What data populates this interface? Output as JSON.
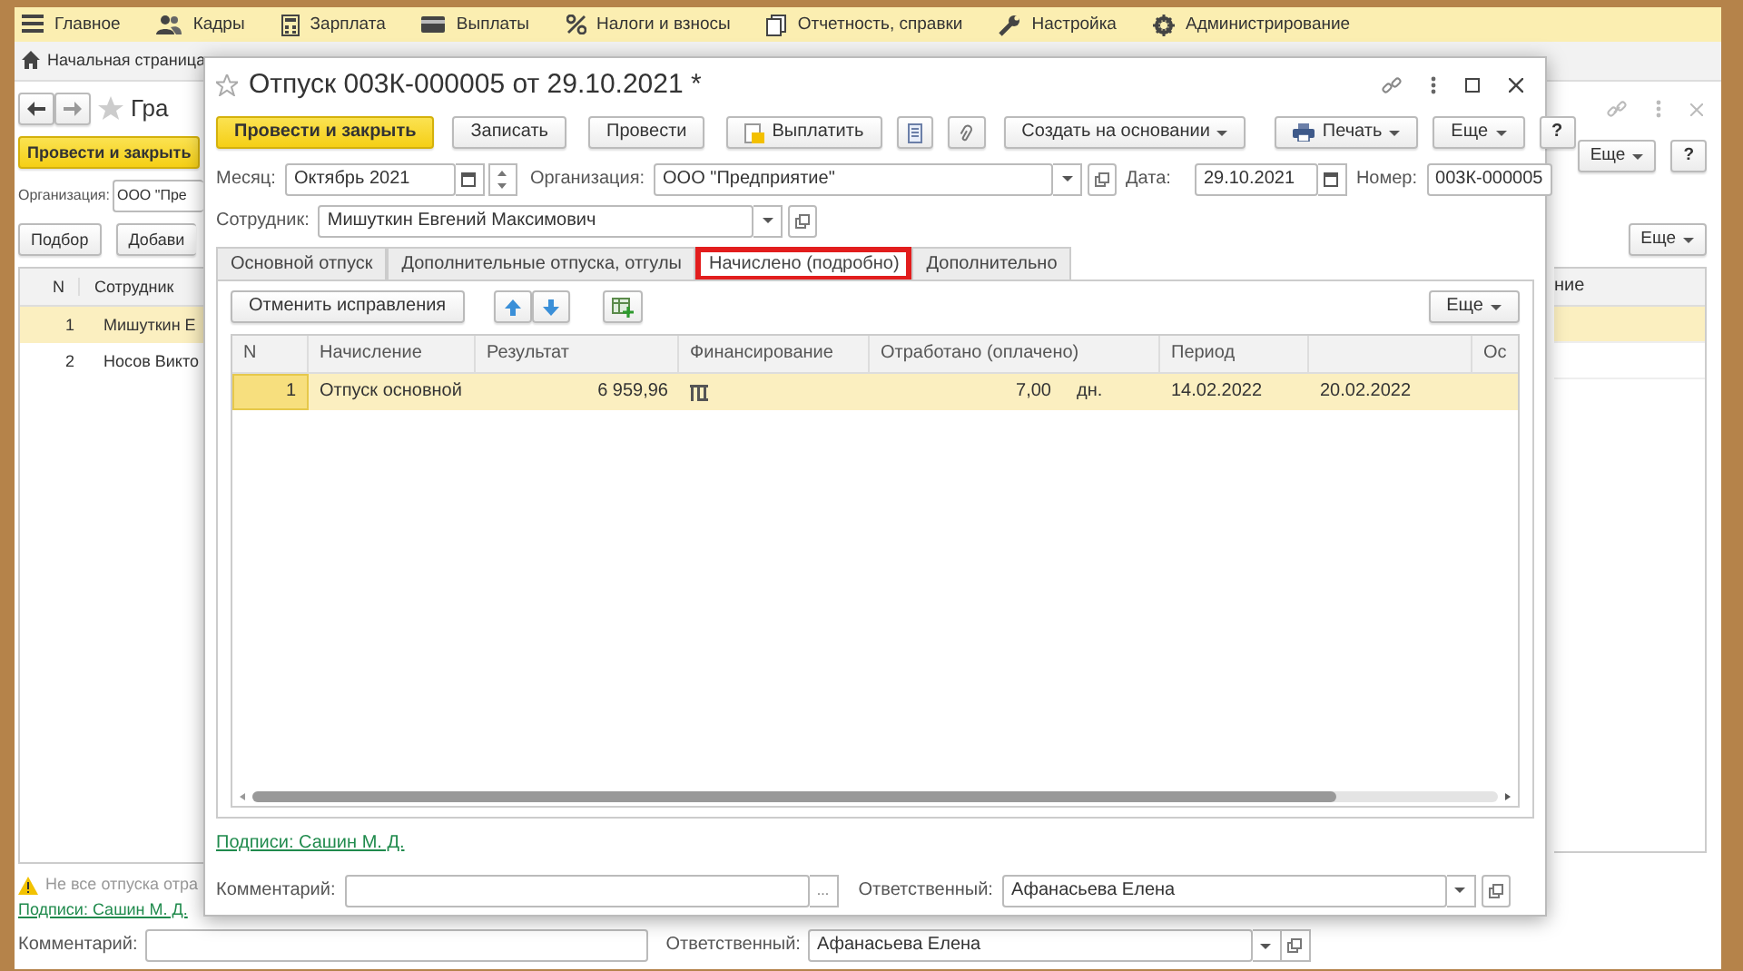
{
  "menu": [
    {
      "label": "Главное"
    },
    {
      "label": "Кадры"
    },
    {
      "label": "Зарплата"
    },
    {
      "label": "Выплаты"
    },
    {
      "label": "Налоги и взносы"
    },
    {
      "label": "Отчетность, справки"
    },
    {
      "label": "Настройка"
    },
    {
      "label": "Администрирование"
    }
  ],
  "home_tab": "Начальная страница",
  "background_form": {
    "title": "Гра",
    "post_close_button": "Провести и закрыть",
    "organization_label": "Организация:",
    "organization_value": "ООО \"Пре",
    "select_button": "Подбор",
    "add_button": "Добави",
    "more_button_top": "Еще",
    "help_button": "?",
    "more_button_table": "Еще",
    "table": {
      "columns": [
        "N",
        "Сотрудник"
      ],
      "right_column": "ние",
      "rows": [
        {
          "n": "1",
          "employee": "Мишуткин Е",
          "selected": true
        },
        {
          "n": "2",
          "employee": "Носов Викто",
          "selected": false
        }
      ]
    },
    "warning": "Не все отпуска отра",
    "signatures_link": "Подписи: Сашин М. Д.",
    "comment_label": "Комментарий:",
    "responsible_label": "Ответственный:",
    "responsible_value": "Афанасьева Елена"
  },
  "document": {
    "title": "Отпуск 003К-000005 от 29.10.2021 *",
    "toolbar": {
      "post_close_button": "Провести и закрыть",
      "save_button": "Записать",
      "post_button": "Провести",
      "pay_button": "Выплатить",
      "create_based_on_button": "Создать на основании",
      "print_button": "Печать",
      "more_button": "Еще",
      "help_button": "?"
    },
    "month_label": "Месяц:",
    "month_value": "Октябрь 2021",
    "organization_label": "Организация:",
    "organization_value": "ООО \"Предприятие\"",
    "date_label": "Дата:",
    "date_value": "29.10.2021",
    "number_label": "Номер:",
    "number_value": "003К-000005",
    "employee_label": "Сотрудник:",
    "employee_value": "Мишуткин Евгений Максимович",
    "tabs": [
      {
        "label": "Основной отпуск",
        "selected": false,
        "highlighted": false
      },
      {
        "label": "Дополнительные отпуска, отгулы",
        "selected": false,
        "highlighted": false
      },
      {
        "label": "Начислено (подробно)",
        "selected": true,
        "highlighted": true
      },
      {
        "label": "Дополнительно",
        "selected": false,
        "highlighted": false
      }
    ],
    "cancel_corrections_button": "Отменить исправления",
    "more_button": "Еще",
    "table": {
      "columns": [
        "N",
        "Начисление",
        "Результат",
        "Финансирование",
        "Отработано (оплачено)",
        "Период",
        "Ос"
      ],
      "rows": [
        {
          "n": "1",
          "accrual": "Отпуск основной",
          "result": "6 959,96",
          "worked": "7,00",
          "unit": "дн.",
          "period_start": "14.02.2022",
          "period_end": "20.02.2022",
          "selected": true
        }
      ]
    },
    "signatures_link": "Подписи: Сашин М. Д.",
    "comment_label": "Комментарий:",
    "choose_button": "...",
    "responsible_label": "Ответственный:",
    "responsible_value": "Афанасьева Елена"
  }
}
